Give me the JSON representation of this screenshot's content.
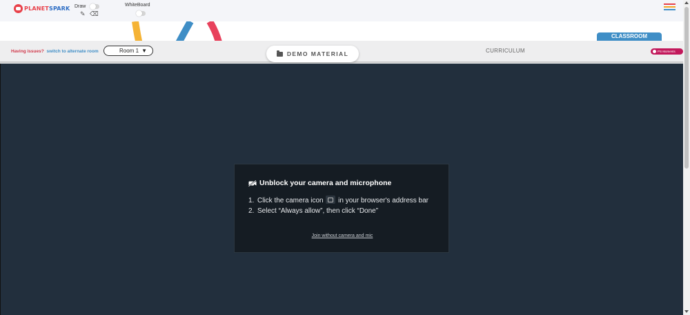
{
  "header": {
    "logo_text_a": "PLANET",
    "logo_text_b": "SPARK",
    "draw_label": "Draw",
    "whiteboard_label": "WhiteBoard"
  },
  "tabs": {
    "classroom_label": "CLASSROOM"
  },
  "subbar": {
    "issues_text": "Having issues?",
    "alternate_link": "switch to alternate room",
    "room_value": "Room 1",
    "demo_material_label": "DEMO MATERIAL",
    "curriculum_label": "CURRICULUM",
    "moments_label": "PS Moments"
  },
  "modal": {
    "title": "Unblock your camera and microphone",
    "step1_num": "1.",
    "step1_before": "Click the camera icon",
    "step1_after": "in your browser's address bar",
    "step2_num": "2.",
    "step2_text": "Select “Always allow”, then click “Done”",
    "join_link": "Join without camera and mic"
  },
  "colors": {
    "brand_red": "#e8414a",
    "brand_blue": "#3f8ec6",
    "video_bg": "#222f3d",
    "moments_pink": "#c2185b"
  },
  "icons": {
    "draw_pencil": "✎",
    "draw_eraser": "⌫",
    "room_caret": "▼"
  }
}
